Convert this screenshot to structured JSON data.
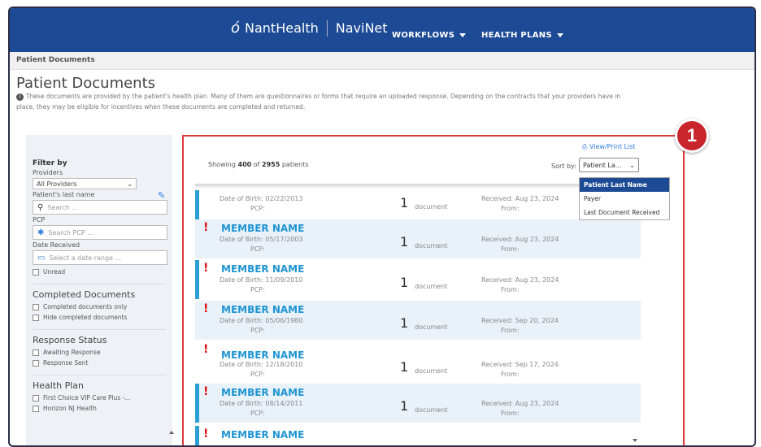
{
  "header": {
    "brand": "NantHealth",
    "product": "NaviNet",
    "nav": [
      {
        "label": "WORKFLOWS"
      },
      {
        "label": "HEALTH PLANS"
      }
    ]
  },
  "breadcrumb": "Patient Documents",
  "page": {
    "title": "Patient Documents",
    "notice": "These documents are provided by the patient's health plan. Many of them are questionnaires or forms that require an uploaded response. Depending on the contracts that your providers have in place, they may be eligible for incentives when these documents are completed and returned."
  },
  "sidebar": {
    "filter_by": "Filter by",
    "providers_label": "Providers",
    "providers_value": "All Providers",
    "last_name_label": "Patient's last name",
    "last_name_placeholder": "Search ...",
    "pcp_label": "PCP",
    "pcp_placeholder": "Search PCP ...",
    "date_label": "Date Received",
    "date_placeholder": "Select a date range ...",
    "unread": "Unread",
    "completed_title": "Completed Documents",
    "completed_only": "Completed documents only",
    "hide_completed": "Hide completed documents",
    "response_title": "Response Status",
    "awaiting": "Awaiting Response",
    "sent": "Response Sent",
    "health_plan_title": "Health Plan",
    "plans": [
      "First Choice VIP Care Plus -...",
      "Horizon NJ Health"
    ]
  },
  "panel": {
    "view_print": "View/Print List",
    "showing_prefix": "Showing",
    "showing_count": "400",
    "showing_of": "of",
    "showing_total": "2955",
    "showing_suffix": "patients",
    "sort_label": "Sort by:",
    "sort_value": "Patient La...",
    "sort_options": [
      "Patient Last Name",
      "Payer",
      "Last Document Received"
    ]
  },
  "rows": [
    {
      "name": "",
      "dob": "Date of Birth: 02/22/2013",
      "count": "1",
      "doc": "document",
      "received": "Received: Aug 23, 2024"
    },
    {
      "name": "MEMBER NAME",
      "dob": "Date of Birth: 05/17/2003",
      "count": "1",
      "doc": "document",
      "received": "Received: Aug 23, 2024"
    },
    {
      "name": "MEMBER NAME",
      "dob": "Date of Birth: 11/09/2010",
      "count": "1",
      "doc": "document",
      "received": "Received: Aug 23, 2024"
    },
    {
      "name": "MEMBER NAME",
      "dob": "Date of Birth: 05/06/1980",
      "count": "1",
      "doc": "document",
      "received": "Received: Sep 20, 2024"
    },
    {
      "name": "MEMBER NAME",
      "dob": "Date of Birth: 12/18/2010",
      "count": "1",
      "doc": "document",
      "received": "Received: Sep 17, 2024"
    },
    {
      "name": "MEMBER NAME",
      "dob": "Date of Birth: 08/14/2011",
      "count": "1",
      "doc": "document",
      "received": "Received: Aug 23, 2024"
    },
    {
      "name": "MEMBER NAME",
      "dob": "",
      "count": "",
      "doc": "",
      "received": ""
    }
  ],
  "row_labels": {
    "pcp": "PCP:",
    "from": "From:"
  },
  "callout": "1",
  "colors": {
    "brand": "#1c4a94",
    "accent": "#1f95d3",
    "highlight": "#e03a3a"
  }
}
